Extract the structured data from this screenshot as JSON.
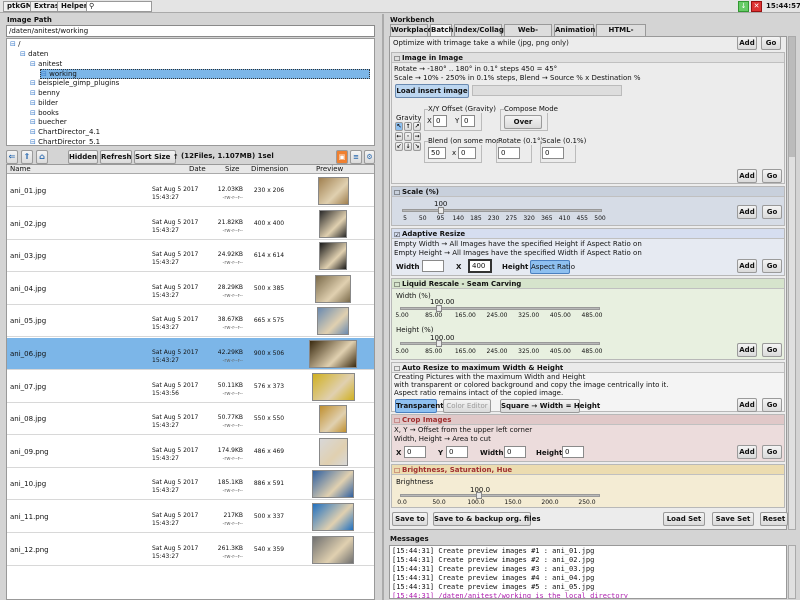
{
  "menu": {
    "items": [
      "ptkGM",
      "Extras",
      "Helper"
    ],
    "clock": "15:44:57",
    "close": "✕"
  },
  "left": {
    "image_path_title": "Image Path",
    "path_value": "/daten/anitest/working",
    "tree": [
      {
        "label": "/",
        "indent": 0
      },
      {
        "label": "daten",
        "indent": 1
      },
      {
        "label": "anitest",
        "indent": 2
      },
      {
        "label": "working",
        "indent": 3
      },
      {
        "label": "beispiele_gimp_plugins",
        "indent": 2
      },
      {
        "label": "benny",
        "indent": 2
      },
      {
        "label": "bilder",
        "indent": 2
      },
      {
        "label": "books",
        "indent": 2
      },
      {
        "label": "buecher",
        "indent": 2
      },
      {
        "label": "ChartDirector_4.1",
        "indent": 2
      },
      {
        "label": "ChartDirector_5.1",
        "indent": 2
      }
    ],
    "toolbar": {
      "hidden": "Hidden",
      "refresh": "Refresh",
      "sort": "Sort Size ↑",
      "info": "(12Files, 1.107MB) 1sel"
    },
    "columns": [
      "Name",
      "Date",
      "Size",
      "Dimension",
      "Preview"
    ],
    "files": [
      {
        "name": "ani_01.jpg",
        "date1": "Sat Aug  5  2017",
        "date2": "15:43:27",
        "size": "12.03KB",
        "perm": "-rw-r--r--",
        "dim": "230 x 206",
        "color": "#a08050",
        "sel": false
      },
      {
        "name": "ani_02.jpg",
        "date1": "Sat Aug  5  2017",
        "date2": "15:43:27",
        "size": "21.82KB",
        "perm": "-rw-r--r--",
        "dim": "400 x 400",
        "color": "#2a2a2a",
        "sel": false
      },
      {
        "name": "ani_03.jpg",
        "date1": "Sat Aug  5  2017",
        "date2": "15:43:27",
        "size": "24.92KB",
        "perm": "-rw-r--r--",
        "dim": "614 x 614",
        "color": "#1a1a1a",
        "sel": false
      },
      {
        "name": "ani_04.jpg",
        "date1": "Sat Aug  5  2017",
        "date2": "15:43:27",
        "size": "28.29KB",
        "perm": "-rw-r--r--",
        "dim": "500 x 385",
        "color": "#7a6a4a",
        "sel": false
      },
      {
        "name": "ani_05.jpg",
        "date1": "Sat Aug  5  2017",
        "date2": "15:43:27",
        "size": "38.67KB",
        "perm": "-rw-r--r--",
        "dim": "665 x 575",
        "color": "#6a8ab0",
        "sel": false
      },
      {
        "name": "ani_06.jpg",
        "date1": "Sat Aug  5  2017",
        "date2": "15:43:27",
        "size": "42.29KB",
        "perm": "-rw-r--r--",
        "dim": "900 x 506",
        "color": "#3a2a10",
        "sel": true
      },
      {
        "name": "ani_07.jpg",
        "date1": "Sat Aug  5  2017",
        "date2": "15:43:56",
        "size": "50.11KB",
        "perm": "-rw-r--r--",
        "dim": "576 x 373",
        "color": "#d0b020",
        "sel": false
      },
      {
        "name": "ani_08.jpg",
        "date1": "Sat Aug  5  2017",
        "date2": "15:43:27",
        "size": "50.77KB",
        "perm": "-rw-r--r--",
        "dim": "550 x 550",
        "color": "#c09030",
        "sel": false
      },
      {
        "name": "ani_09.png",
        "date1": "Sat Aug  5  2017",
        "date2": "15:43:27",
        "size": "174.9KB",
        "perm": "-rw-r--r--",
        "dim": "486 x 469",
        "color": "#d8d8d8",
        "sel": false
      },
      {
        "name": "ani_10.jpg",
        "date1": "Sat Aug  5  2017",
        "date2": "15:43:27",
        "size": "185.1KB",
        "perm": "-rw-r--r--",
        "dim": "886 x 591",
        "color": "#3060a0",
        "sel": false
      },
      {
        "name": "ani_11.png",
        "date1": "Sat Aug  5  2017",
        "date2": "15:43:27",
        "size": "217KB",
        "perm": "-rw-r--r--",
        "dim": "500 x 337",
        "color": "#2070c0",
        "sel": false
      },
      {
        "name": "ani_12.png",
        "date1": "Sat Aug  5  2017",
        "date2": "15:43:27",
        "size": "261.3KB",
        "perm": "-rw-r--r--",
        "dim": "540 x 359",
        "color": "#707070",
        "sel": false
      }
    ]
  },
  "right": {
    "workbench_title": "Workbench",
    "tabs": [
      "Workplace",
      "Batch",
      "Index/Collage",
      "Web-Gallery",
      "Animation",
      "HTML-Editor"
    ],
    "active_tab": "Batch",
    "top_note": "Optimize with trimage take a while (jpg, png only)",
    "add": "Add",
    "go": "Go",
    "insert": {
      "title": "Image in Image",
      "line1": "Rotate  → -180° .. 180° in 0.1° steps  450 = 45°",
      "line2": "Scale   → 10% - 250% in 0.1% steps, Blend → Source % x Destination %",
      "load_btn": "Load insert image",
      "gravity": "Gravity",
      "xy_offset": "X/Y Offset (Gravity)",
      "compose": "Compose Mode",
      "x": "X",
      "y": "Y",
      "x_val": "0",
      "y_val": "0",
      "compose_val": "Over",
      "blend": "Blend (on some modes)",
      "blend_a": "50",
      "blend_b": "0",
      "rotate": "Rotate (0.1°)",
      "rotate_val": "0",
      "scale": "Scale (0.1%)",
      "scale_val": "0"
    },
    "scale": {
      "title": "Scale (%)",
      "value": "100",
      "ticks": [
        "5",
        "50",
        "95",
        "140",
        "185",
        "230",
        "275",
        "320",
        "365",
        "410",
        "455",
        "500"
      ]
    },
    "adaptive": {
      "title": "Adaptive Resize",
      "line1": "Empty Width  → All Images have the specified Height if Aspect Ratio on",
      "line2": "Empty Height → All Images have the specified Width if Aspect Ratio on",
      "width": "Width",
      "x": "X",
      "height_val": "400",
      "height": "Height",
      "aspect": "Aspect Ratio"
    },
    "liquid": {
      "title": "Liquid Rescale - Seam Carving",
      "width_label": "Width (%)",
      "width_val": "100.00",
      "height_label": "Height (%)",
      "height_val": "100.00",
      "ticks": [
        "5.00",
        "85.00",
        "165.00",
        "245.00",
        "325.00",
        "405.00",
        "485.00"
      ]
    },
    "autoresize": {
      "title": "Auto Resize to maximum Width & Height",
      "line1": "Creating Pictures with the maximum Width and Height",
      "line2": "with transparent or colored background and copy the image centrically into it.",
      "line3": "Aspect ratio remains intact of the copied image.",
      "transparent": "Transparent",
      "color": "Color Editor",
      "square": "Square → Width = Height"
    },
    "crop": {
      "title": "Crop Images",
      "line1": "X, Y → Offset from the upper left corner",
      "line2": "Width, Height → Area to cut",
      "x": "X",
      "x_val": "0",
      "y": "Y",
      "y_val": "0",
      "width": "Width",
      "width_val": "0",
      "height": "Height",
      "height_val": "0"
    },
    "brightness": {
      "title": "Brightness, Saturation, Hue",
      "label": "Brightness",
      "value": "100.0",
      "ticks": [
        "0.0",
        "50.0",
        "100.0",
        "150.0",
        "200.0",
        "250.0"
      ]
    },
    "bottom": {
      "save_to": "Save to",
      "backup": "Save to & backup org. files",
      "load_set": "Load Set",
      "save_set": "Save Set",
      "reset": "Reset"
    },
    "messages_title": "Messages",
    "messages": [
      {
        "text": "[15:44:31] Create preview images #1 : ani_01.jpg",
        "color": "#111"
      },
      {
        "text": "[15:44:31] Create preview images #2 : ani_02.jpg",
        "color": "#111"
      },
      {
        "text": "[15:44:31] Create preview images #3 : ani_03.jpg",
        "color": "#111"
      },
      {
        "text": "[15:44:31] Create preview images #4 : ani_04.jpg",
        "color": "#111"
      },
      {
        "text": "[15:44:31] Create preview images #5 : ani_05.jpg",
        "color": "#111"
      },
      {
        "text": "[15:44:31] /daten/anitest/working is the local directory",
        "color": "#b020b0"
      }
    ]
  }
}
